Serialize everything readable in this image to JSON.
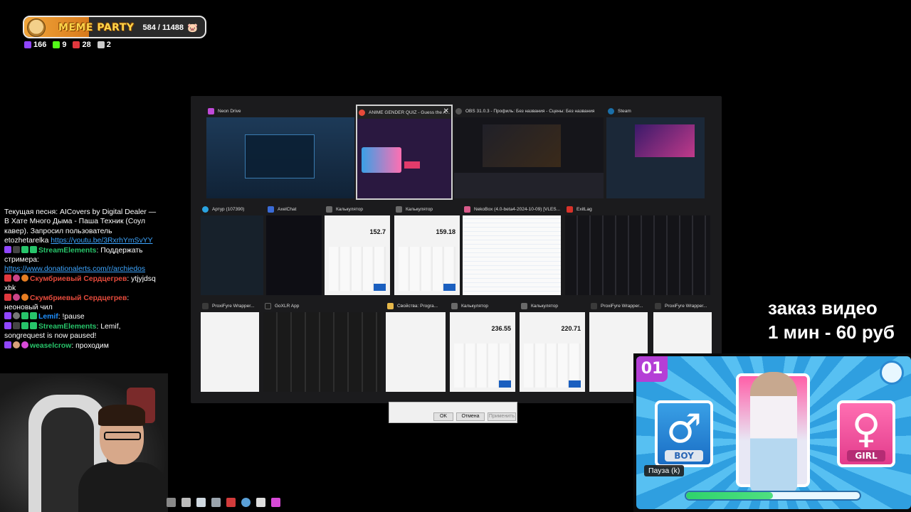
{
  "meme_party": {
    "title": "MEME PARTY",
    "count": "584 / 11488",
    "icon": "pig-icon",
    "progress_fraction": 0.051
  },
  "viewer_stats": [
    {
      "icon": "twitch-icon",
      "value": "166",
      "color": "#9146ff"
    },
    {
      "icon": "kick-icon",
      "value": "9",
      "color": "#53fc18"
    },
    {
      "icon": "live-icon",
      "value": "28",
      "color": "#e0383e"
    },
    {
      "icon": "w-icon",
      "value": "2",
      "color": "#cccccc"
    }
  ],
  "switcher": {
    "row1": [
      {
        "title": "Neon Drive",
        "icon": "neon-drive-icon",
        "color": "#c04ad8"
      },
      {
        "title": "ANIME GENDER QUIZ - Guess the A...",
        "icon": "chrome-icon",
        "color": "#e64a3a",
        "selected": true
      },
      {
        "title": "OBS 31.0.3 - Профиль: Без названия - Сцены: Без названия",
        "icon": "obs-icon",
        "color": "#444444"
      },
      {
        "title": "Steam",
        "icon": "steam-icon",
        "color": "#1b6fa8"
      }
    ],
    "row2": [
      {
        "title": "Артур (107390)",
        "icon": "telegram-icon",
        "color": "#2aa3e0"
      },
      {
        "title": "AxelChat",
        "icon": "axelchat-icon",
        "color": "#3a6bd6"
      },
      {
        "title": "Калькулятор",
        "icon": "calculator-icon",
        "color": "#6a6a6a",
        "value": "152.7"
      },
      {
        "title": "Калькулятор",
        "icon": "calculator-icon",
        "color": "#6a6a6a",
        "value": "159.18"
      },
      {
        "title": "NekoBox (4.0-beta4-2024-10-09) [VLES...",
        "icon": "nekobox-icon",
        "color": "#d85a8a"
      },
      {
        "title": "ExitLag",
        "icon": "exitlag-icon",
        "color": "#d8322a"
      }
    ],
    "row3": [
      {
        "title": "ProxiFyre Wrapper...",
        "icon": "proxifyre-icon",
        "color": "#3a3a3a"
      },
      {
        "title": "GoXLR App",
        "icon": "goxlr-icon",
        "color": "#1e1e1e"
      },
      {
        "title": "Свойства: Progra...",
        "icon": "folder-icon",
        "color": "#e7b84a"
      },
      {
        "title": "Калькулятор",
        "icon": "calculator-icon",
        "color": "#6a6a6a",
        "value": "236.55"
      },
      {
        "title": "Калькулятор",
        "icon": "calculator-icon",
        "color": "#6a6a6a",
        "value": "220.71"
      },
      {
        "title": "ProxiFyre Wrapper...",
        "icon": "proxifyre-icon",
        "color": "#3a3a3a"
      },
      {
        "title": "ProxiFyre Wrapper...",
        "icon": "proxifyre-icon",
        "color": "#3a3a3a"
      }
    ],
    "props_dialog": {
      "ok": "OK",
      "cancel": "Отмена",
      "apply": "Применить"
    }
  },
  "chat": {
    "now_playing": "Текущая песня: AICovers by Digital Dealer — В Хате Много Дыма - Паша Техник (Соул кавер). Запросил пользователь etozhetarelka",
    "now_playing_link": "https://youtu.be/3RxrhYmSvYY",
    "messages": [
      {
        "name": "StreamElements",
        "name_color": "green",
        "text": "Поддержать стримера:",
        "link": "https://www.donationalerts.com/r/archiedos"
      },
      {
        "name": "Скумбриевый Сердцегрев",
        "name_color": "red",
        "text": "ytjyjdsq xbk"
      },
      {
        "name": "Скумбриевый Сердцегрев",
        "name_color": "red",
        "text": "неоновый чил"
      },
      {
        "name": "Lemif",
        "name_color": "blue",
        "text": "!pause"
      },
      {
        "name": "StreamElements",
        "name_color": "green",
        "text": "Lemif, songrequest is now paused!"
      },
      {
        "name": "weaselcrow",
        "name_color": "green",
        "text": "проходим"
      }
    ]
  },
  "taskbar": [
    {
      "icon": "app1-icon",
      "color": "#888888"
    },
    {
      "icon": "gpu-icon",
      "color": "#bbbbbb"
    },
    {
      "icon": "doc-icon",
      "color": "#cfd8e0"
    },
    {
      "icon": "calc-icon",
      "color": "#9aa4ad"
    },
    {
      "icon": "x-icon",
      "color": "#d23b3b"
    },
    {
      "icon": "steam-icon",
      "color": "#5aa0d8"
    },
    {
      "icon": "bars-icon",
      "color": "#dddddd"
    },
    {
      "icon": "anime-icon",
      "color": "#d84ad8"
    }
  ],
  "promo": {
    "line1": "заказ видео",
    "line2": "1 мин - 60 руб"
  },
  "game": {
    "round": "01",
    "boy_label": "BOY",
    "girl_label": "GIRL",
    "pause": "Пауза (k)",
    "progress_fraction": 0.5
  }
}
